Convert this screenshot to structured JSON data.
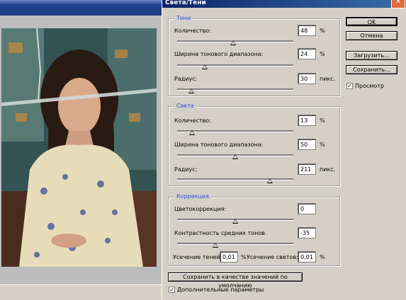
{
  "dialog": {
    "title": "Света/Тени",
    "close_icon": "close-icon"
  },
  "shadows": {
    "legend": "Тени",
    "amount": {
      "label": "Количество:",
      "value": "48",
      "unit": "%",
      "level": 0.48
    },
    "tonal_width": {
      "label": "Ширина тонового диапазона:",
      "value": "24",
      "unit": "%",
      "level": 0.24
    },
    "radius": {
      "label": "Радиус:",
      "value": "30",
      "unit": "пикс.",
      "level": 0.12
    }
  },
  "highlights": {
    "legend": "Света",
    "amount": {
      "label": "Количество:",
      "value": "13",
      "unit": "%",
      "level": 0.13
    },
    "tonal_width": {
      "label": "Ширина тонового диапазона:",
      "value": "50",
      "unit": "%",
      "level": 0.5
    },
    "radius": {
      "label": "Радиус:",
      "value": "211",
      "unit": "пикс.",
      "level": 0.8
    }
  },
  "adjustments": {
    "legend": "Коррекция",
    "color_correction": {
      "label": "Цветокоррекция:",
      "value": "0",
      "level": 0.5
    },
    "midtone_contrast": {
      "label": "Контрастность средних тонов",
      "value": "-35",
      "level": 0.33
    },
    "black_clip": {
      "label": "Усечение теней:",
      "value": "0,01",
      "unit": "%"
    },
    "white_clip": {
      "label": "Усечение светов:",
      "value": "0,01",
      "unit": "%"
    }
  },
  "buttons": {
    "ok": "OK",
    "cancel": "Отмена",
    "load": "Загрузить...",
    "save": "Сохранить...",
    "save_defaults": "Сохранить в качестве значений по умолчанию"
  },
  "checkboxes": {
    "preview": {
      "label": "Просмотр",
      "checked": true
    },
    "more_options": {
      "label": "Дополнительные параметры",
      "checked": true
    }
  },
  "colors": {
    "accent_legend": "#2a4fd6",
    "titlebar": "#0a246a",
    "close_button": "#e26a3c"
  }
}
